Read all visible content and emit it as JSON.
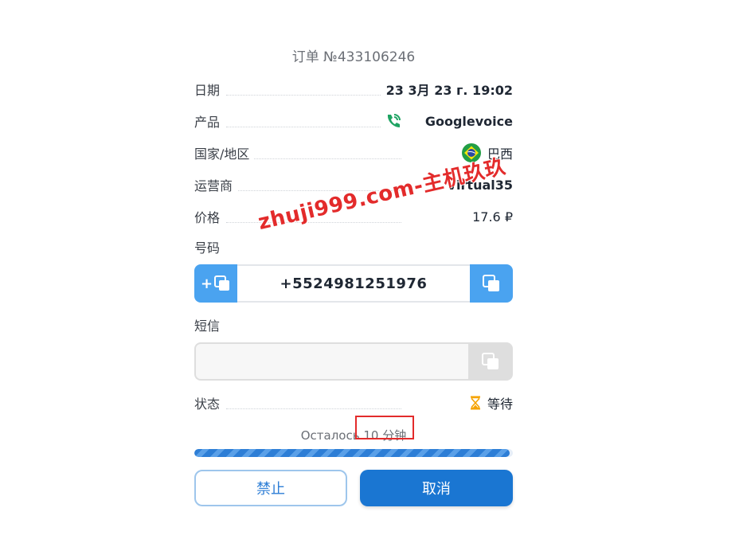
{
  "order": {
    "title": "订单 №433106246"
  },
  "details": {
    "date_label": "日期",
    "date_value": "23 3月 23 г. 19:02",
    "product_label": "产品",
    "product_value": "Googlevoice",
    "country_label": "国家/地区",
    "country_value": "巴西",
    "operator_label": "运营商",
    "operator_value": "Virtual35",
    "price_label": "价格",
    "price_value": "17.6 ₽"
  },
  "number": {
    "label": "号码",
    "value": "+5524981251976",
    "add_glyph": "+"
  },
  "sms": {
    "label": "短信",
    "value": ""
  },
  "status": {
    "label": "状态",
    "value": "等待"
  },
  "timer": {
    "prefix": "Осталось",
    "minutes": "10",
    "unit": "分钟",
    "progress_fraction": 0.99
  },
  "actions": {
    "ban_label": "禁止",
    "cancel_label": "取消"
  },
  "watermark": {
    "text": "zhuji999.com-主机玖玖"
  },
  "colors": {
    "accent": "#1a76d2",
    "light_accent": "#4aa3f0",
    "highlight": "#e32b2b",
    "status_icon": "#f5a300"
  }
}
